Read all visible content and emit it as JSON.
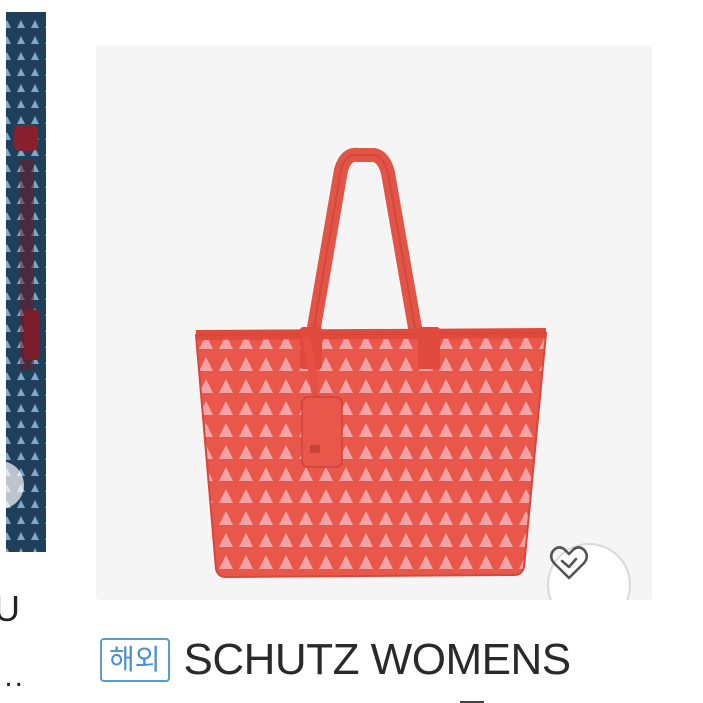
{
  "left_card": {
    "title_line1": "U",
    "title_line2": "..."
  },
  "main_card": {
    "image_alt": "SCHUTZ coral triangle pattern tote bag",
    "badge_label": "해외",
    "title": "SCHUTZ WOMENS",
    "wish_icon": "heart-icon",
    "bag_color": "#e8574a",
    "pattern_color": "#f3a3a6"
  }
}
